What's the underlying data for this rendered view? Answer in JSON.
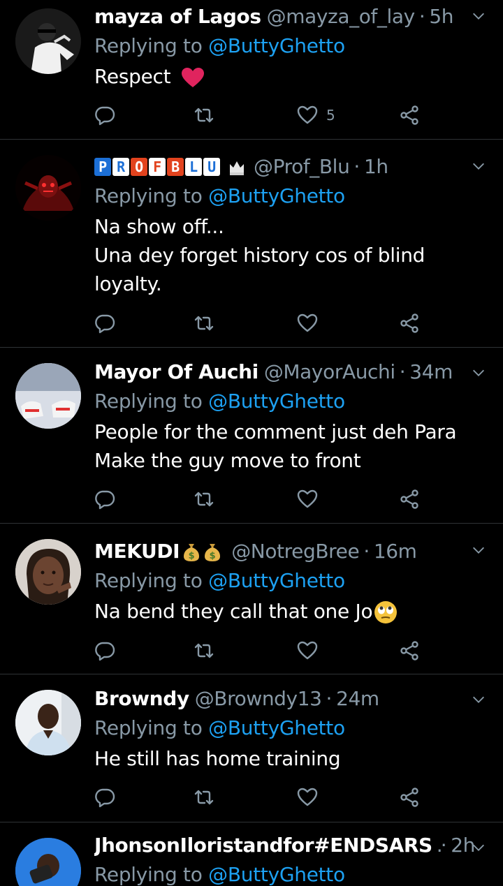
{
  "colors": {
    "background": "#000000",
    "secondary_text": "#8899a6",
    "mention": "#1da1f2",
    "divider": "#2f3336",
    "heart": "#e0245e"
  },
  "icons": {
    "reply": "reply-icon",
    "retweet": "retweet-icon",
    "like": "heart-icon",
    "share": "share-icon",
    "menu": "chevron-down-icon"
  },
  "reply_prefix": "Replying to",
  "reply_target": "@ButtyGhetto",
  "tweets": [
    {
      "name": "mayza of Lagos",
      "handle": "@mayza_of_lay",
      "time": "5h",
      "lines": [
        "Respect"
      ],
      "likes": "5"
    },
    {
      "name_letters": [
        "P",
        "R",
        "O",
        "F",
        "B",
        "L",
        "U"
      ],
      "handle": "@Prof_Blu",
      "time": "1h",
      "lines": [
        "Na show off...",
        "Una dey forget history cos of blind",
        "loyalty."
      ],
      "likes": ""
    },
    {
      "name": "Mayor Of Auchi",
      "handle": "@MayorAuchi",
      "time": "34m",
      "lines": [
        "People for the comment just deh Para",
        "Make the guy move to front"
      ],
      "likes": ""
    },
    {
      "name": "MEKUDI",
      "handle": "@NotregBree",
      "time": "16m",
      "lines": [
        "Na bend they call that one Jo"
      ],
      "likes": ""
    },
    {
      "name": "Browndy",
      "handle": "@Browndy13",
      "time": "24m",
      "lines": [
        "He still has home training"
      ],
      "likes": ""
    },
    {
      "name": "JhonsonIloristandfor#ENDSARS",
      "ellipsis": "...",
      "handle": "",
      "time": "2h",
      "lines": [],
      "likes": ""
    }
  ]
}
